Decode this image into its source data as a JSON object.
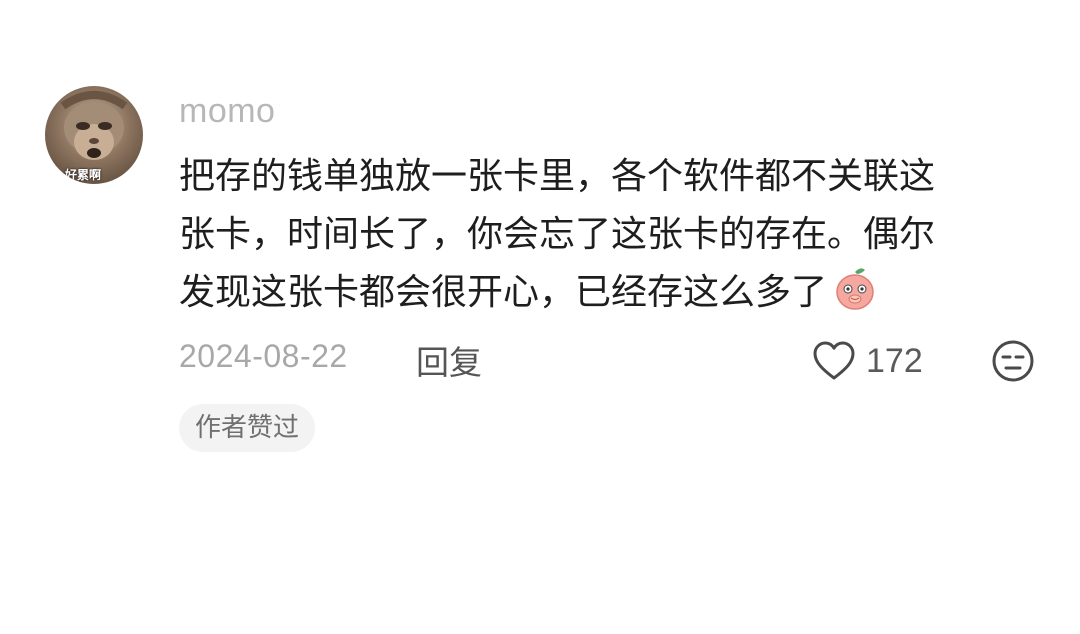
{
  "comment": {
    "username": "momo",
    "avatar_caption": "好累啊",
    "lines": [
      "把存的钱单独放一张卡里，各个软件都不关联这",
      "张卡，时间长了，你会忘了这张卡的存在。偶尔",
      "发现这张卡都会很开心，已经存这么多了"
    ],
    "emoji": "peach-face-emoji",
    "date": "2024-08-22",
    "reply_label": "回复",
    "like_count": "172",
    "author_badge": "作者赞过"
  },
  "icons": {
    "like": "heart-outline-icon",
    "dislike": "neutral-face-icon"
  },
  "colors": {
    "background": "#ffffff",
    "username": "#b7b7b7",
    "body_text": "#1e1e1e",
    "meta_text": "#a8a8a8",
    "badge_bg": "#f3f3f3"
  }
}
